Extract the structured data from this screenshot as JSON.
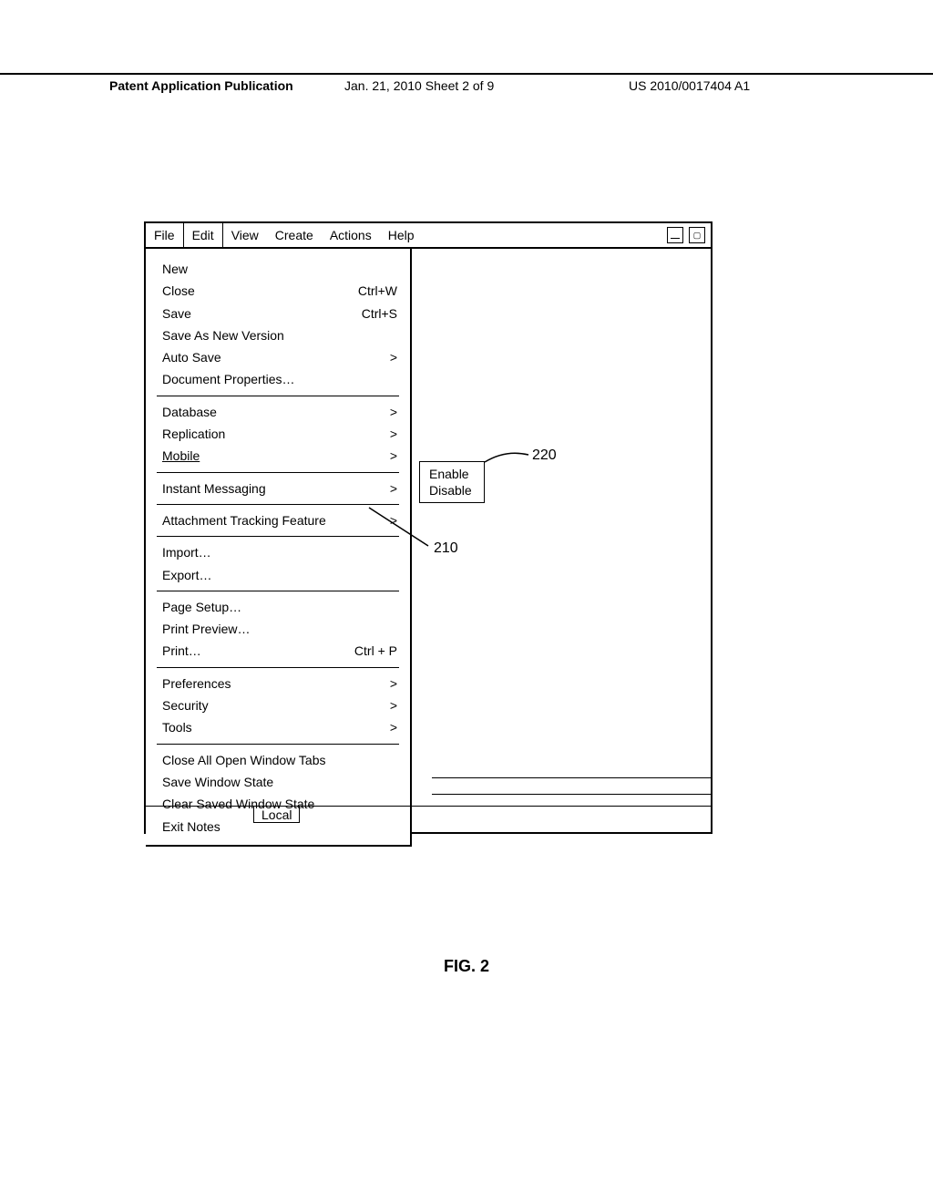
{
  "header": {
    "left": "Patent Application Publication",
    "mid": "Jan. 21, 2010  Sheet 2 of 9",
    "right": "US 2010/0017404 A1"
  },
  "menubar": [
    "File",
    "Edit",
    "View",
    "Create",
    "Actions",
    "Help"
  ],
  "menu": {
    "group1": [
      {
        "label": "New",
        "accel": "",
        "arrow": false
      },
      {
        "label": "Close",
        "accel": "Ctrl+W",
        "arrow": false
      },
      {
        "label": "Save",
        "accel": "Ctrl+S",
        "arrow": false
      },
      {
        "label": "Save As New Version",
        "accel": "",
        "arrow": false
      },
      {
        "label": "Auto Save",
        "accel": "",
        "arrow": true
      },
      {
        "label": "Document Properties…",
        "accel": "",
        "arrow": false
      }
    ],
    "group2": [
      {
        "label": "Database",
        "accel": "",
        "arrow": true
      },
      {
        "label": "Replication",
        "accel": "",
        "arrow": true
      },
      {
        "label": "Mobile",
        "accel": "",
        "arrow": true,
        "underline": true
      }
    ],
    "group3": [
      {
        "label": "Instant Messaging",
        "accel": "",
        "arrow": true
      }
    ],
    "group4": [
      {
        "label": "Attachment Tracking Feature",
        "accel": "",
        "arrow": true
      }
    ],
    "group5": [
      {
        "label": "Import…",
        "accel": "",
        "arrow": false
      },
      {
        "label": "Export…",
        "accel": "",
        "arrow": false
      }
    ],
    "group6": [
      {
        "label": "Page Setup…",
        "accel": "",
        "arrow": false
      },
      {
        "label": "Print Preview…",
        "accel": "",
        "arrow": false
      },
      {
        "label": "Print…",
        "accel": "Ctrl + P",
        "arrow": false
      }
    ],
    "group7": [
      {
        "label": "Preferences",
        "accel": "",
        "arrow": true
      },
      {
        "label": "Security",
        "accel": "",
        "arrow": true
      },
      {
        "label": "Tools",
        "accel": "",
        "arrow": true
      }
    ],
    "group8": [
      {
        "label": "Close All Open Window Tabs",
        "accel": "",
        "arrow": false
      },
      {
        "label": "Save Window State",
        "accel": "",
        "arrow": false
      },
      {
        "label": "Clear Saved Window State",
        "accel": "",
        "arrow": false
      },
      {
        "label": "Exit Notes",
        "accel": "",
        "arrow": false
      }
    ]
  },
  "submenu": {
    "items": [
      "Enable",
      "Disable"
    ]
  },
  "callouts": {
    "c210": "210",
    "c220": "220"
  },
  "local": "Local",
  "figure": "FIG. 2"
}
